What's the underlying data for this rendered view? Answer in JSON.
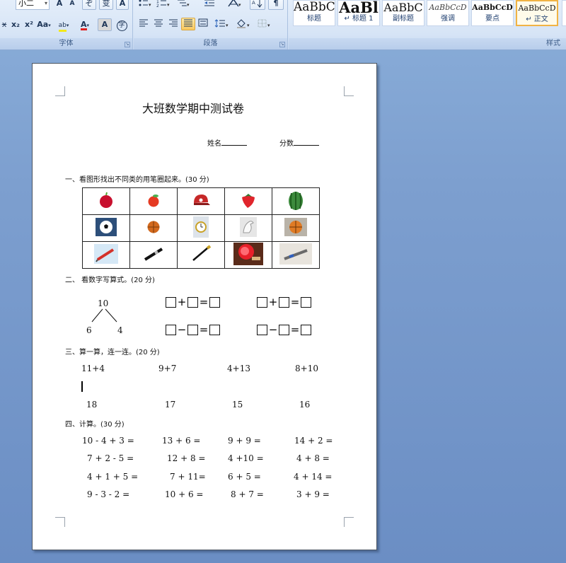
{
  "ribbon": {
    "font_group": {
      "label": "字体",
      "font_size_value": "小二",
      "grow_font": "A",
      "shrink_font": "A",
      "clear_format": "ぞ",
      "phonetic": "变",
      "char_border": "A",
      "strikethrough": "x",
      "subscript": "x₂",
      "superscript": "x²",
      "change_case": "Aa",
      "highlight": "ab",
      "font_color": "A",
      "char_shading": "A",
      "enclose_char": "字"
    },
    "paragraph_group": {
      "label": "段落"
    },
    "styles_group": {
      "label": "样式",
      "tiles": [
        {
          "sample": "AaBbC",
          "name": "标题"
        },
        {
          "sample": "AaBl",
          "name": "↵ 标题 1"
        },
        {
          "sample": "AaBbC",
          "name": "副标题"
        },
        {
          "sample": "AaBbCcD",
          "name": "强调"
        },
        {
          "sample": "AaBbCcD",
          "name": "要点"
        },
        {
          "sample": "AaBbCcD",
          "name": "↵ 正文"
        }
      ]
    }
  },
  "doc": {
    "title": "大班数学期中测试卷",
    "name_label": "姓名",
    "score_label": "分数",
    "sec1": "一、看图形找出不同类的用笔圈起来。(30 分)",
    "pic_rows": [
      [
        "apple-icon",
        "apple-icon",
        "cap-icon",
        "strawberry-icon",
        "watermelon-icon"
      ],
      [
        "soccer-ball-icon",
        "basketball-icon",
        "clock-icon",
        "bird-icon",
        "basketball-icon"
      ],
      [
        "pen-icon",
        "pen-icon",
        "brush-icon",
        "ping-pong-paddle-icon",
        "pen-icon"
      ]
    ],
    "sec2": "二、  看数字写算式。(20 分)",
    "tree_top": "10",
    "tree_left": "6",
    "tree_right": "4",
    "plus": "+",
    "minus": "−",
    "equals": "=",
    "sec3": "三、算一算，连一连。(20 分)",
    "exprs": [
      "11+4",
      "9+7",
      "4+13",
      "8+10"
    ],
    "answers": [
      "18",
      "17",
      "15",
      "16"
    ],
    "sec4": "四、计算。(30 分)",
    "calc_rows": [
      [
        "10 - 4 + 3 =",
        "13 + 6 =",
        "9 + 9 =",
        "14 + 2 ="
      ],
      [
        "7 + 2 - 5 =",
        "12 + 8 =",
        "4 +10 =",
        "4 + 8 ="
      ],
      [
        "4 + 1 + 5 =",
        "7 + 11=",
        "6 + 5 =",
        "4 + 14 ="
      ],
      [
        "9 - 3 - 2 =",
        "10 + 6 =",
        "8 + 7 =",
        "3 + 9 ="
      ]
    ]
  }
}
